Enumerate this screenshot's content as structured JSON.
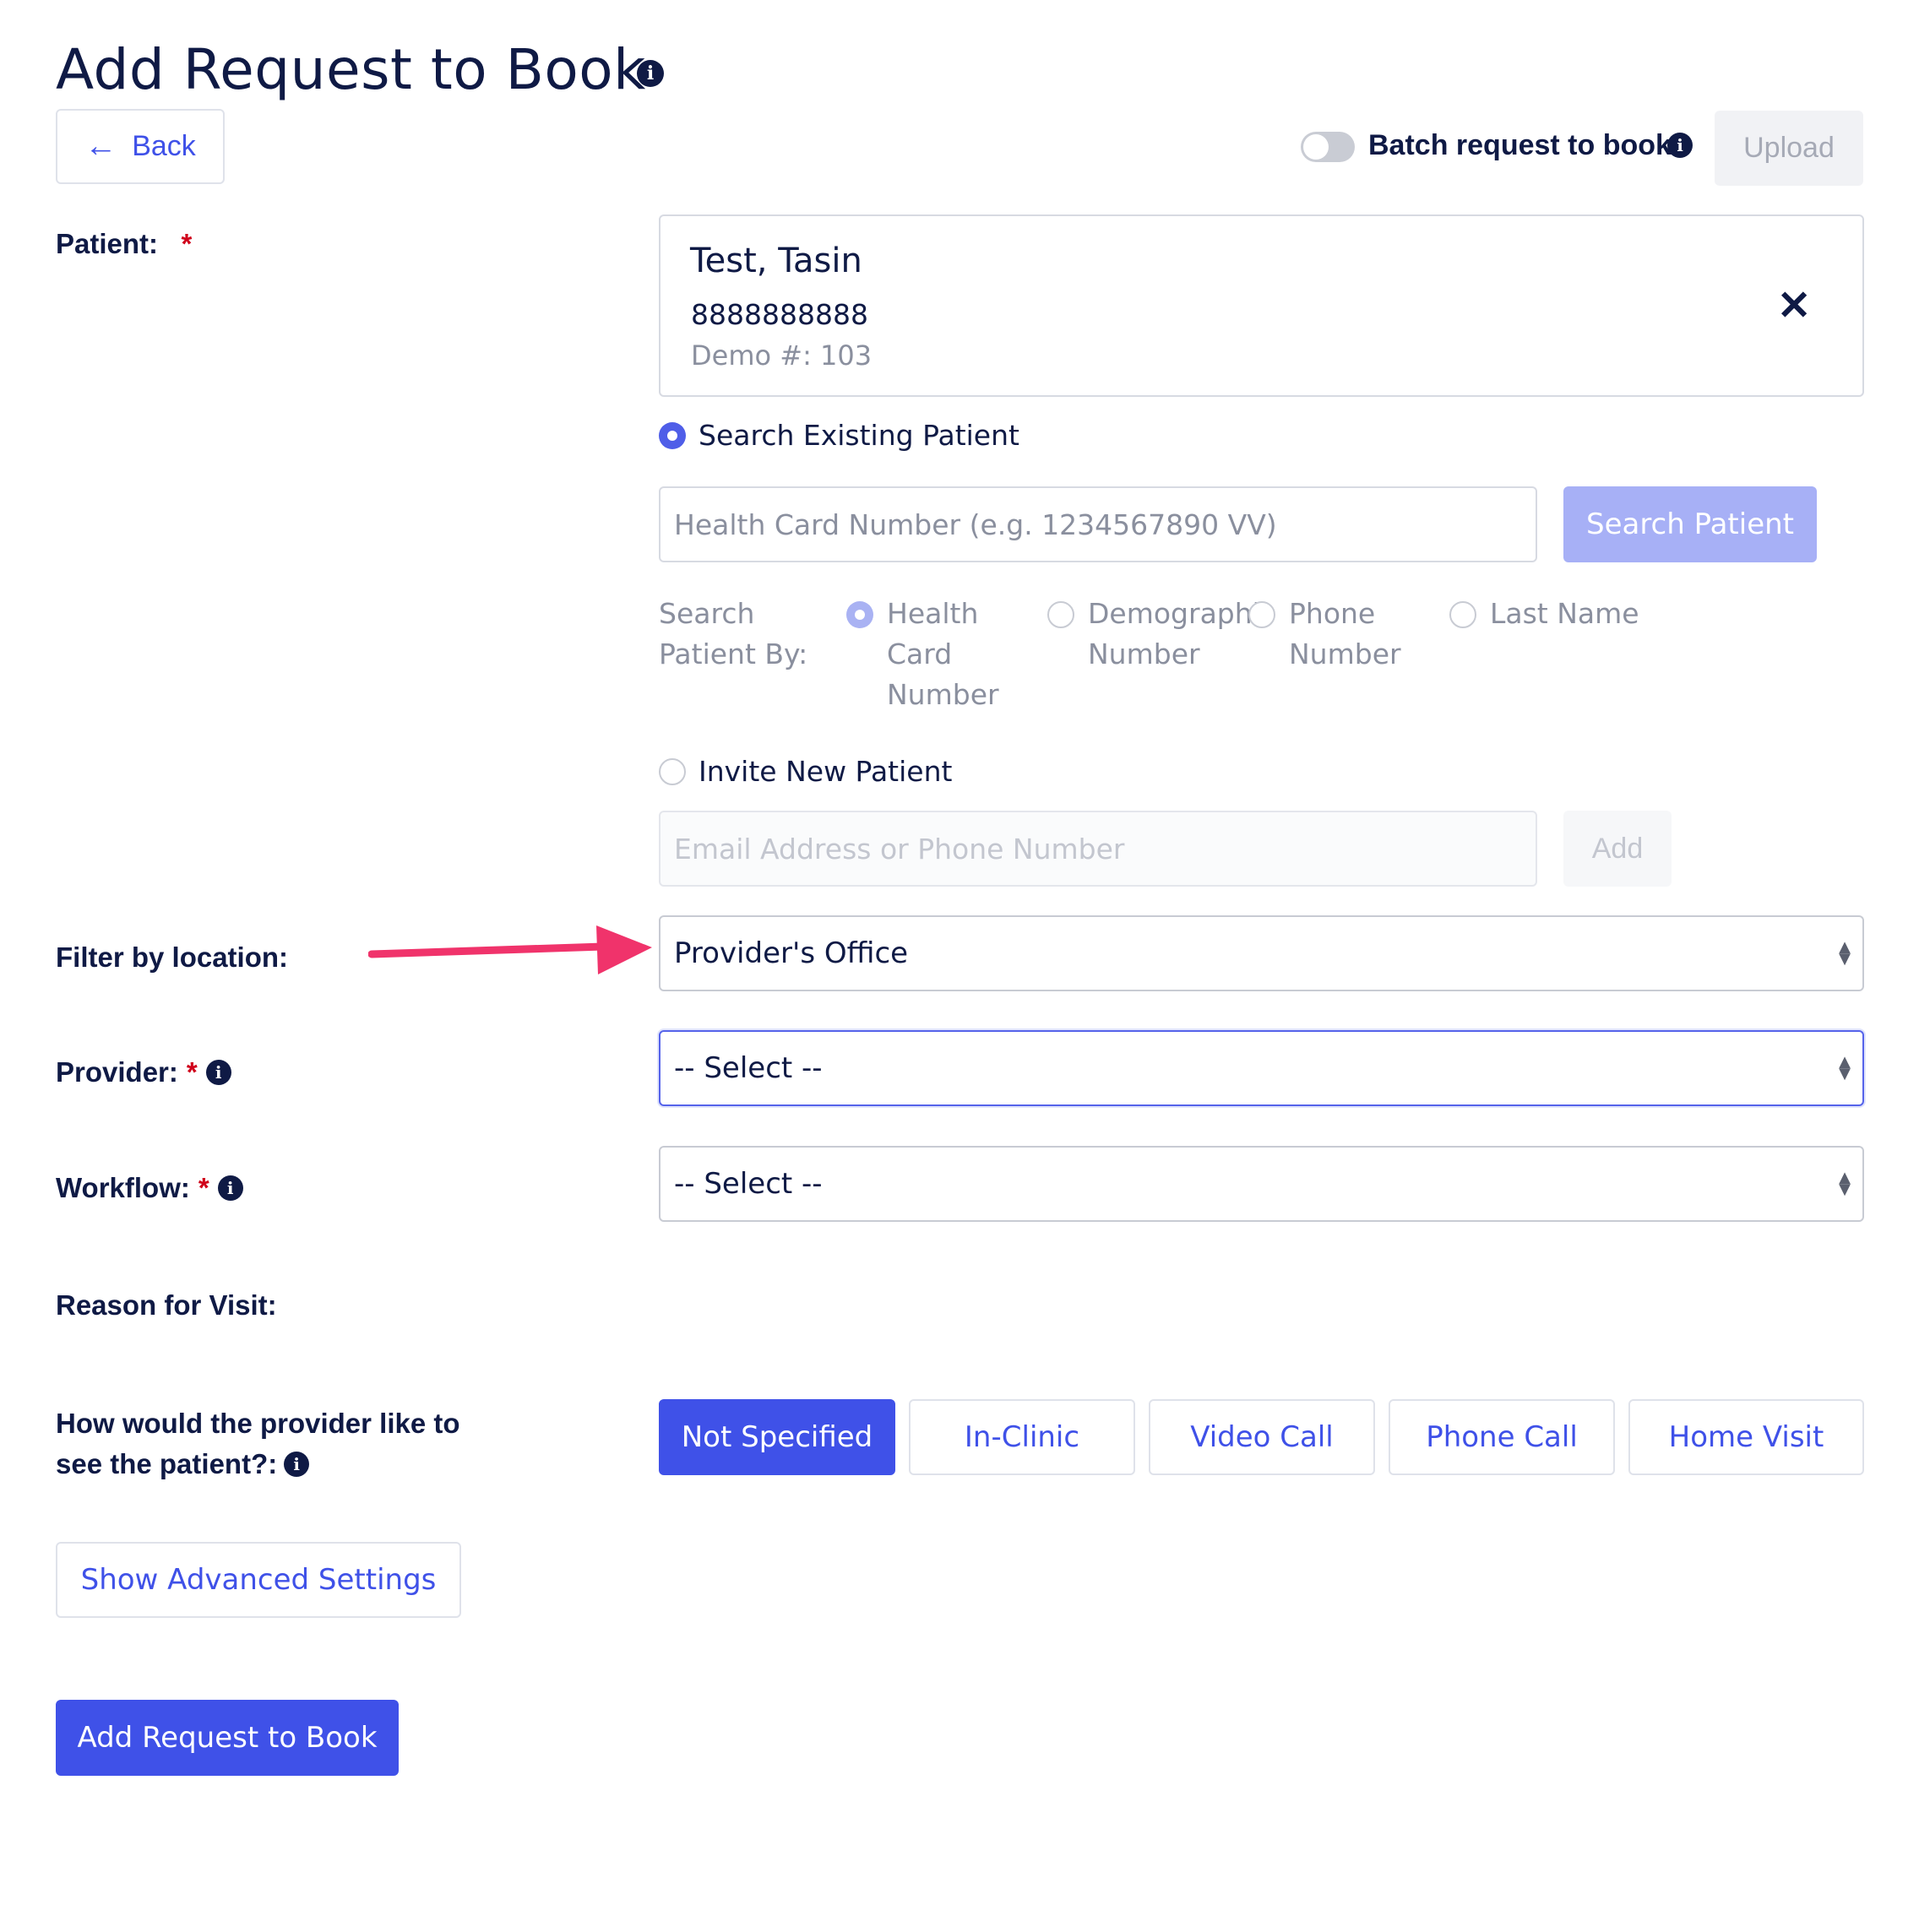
{
  "header": {
    "title": "Add Request to Book",
    "info_icon": "info-icon"
  },
  "toolbar": {
    "back_label": "Back",
    "back_icon": "arrow-left-icon",
    "batch_toggle_on": false,
    "batch_label": "Batch request to book",
    "upload_label": "Upload"
  },
  "patient": {
    "label": "Patient:",
    "required_mark": "*",
    "selected": {
      "name": "Test, Tasin",
      "phone": "8888888888",
      "demo": "Demo #: 103",
      "close_icon": "close-icon"
    },
    "search_existing_label": "Search Existing Patient",
    "search_placeholder": "Health Card Number (e.g. 1234567890 VV)",
    "search_button": "Search Patient",
    "search_by_label": [
      "Search",
      "Patient By:"
    ],
    "search_by_options": [
      {
        "lines": [
          "Health",
          "Card",
          "Number"
        ],
        "selected": true
      },
      {
        "lines": [
          "Demographic",
          "Number"
        ],
        "selected": false
      },
      {
        "lines": [
          "Phone",
          "Number"
        ],
        "selected": false
      },
      {
        "lines": [
          "Last Name"
        ],
        "selected": false
      }
    ],
    "invite_label": "Invite New Patient",
    "invite_placeholder": "Email Address or Phone Number",
    "invite_button": "Add"
  },
  "location": {
    "label": "Filter by location:",
    "value": "Provider's Office",
    "annotation_color": "#f0336b"
  },
  "provider": {
    "label": "Provider:",
    "required_mark": "*",
    "value": "-- Select --"
  },
  "workflow": {
    "label": "Workflow:",
    "required_mark": "*",
    "value": "-- Select --"
  },
  "reason": {
    "label": "Reason for Visit:"
  },
  "visit_mode": {
    "label_line1": "How would the provider like to",
    "label_line2": "see the patient?:",
    "options": [
      "Not Specified",
      "In-Clinic",
      "Video Call",
      "Phone Call",
      "Home Visit"
    ],
    "selected": "Not Specified"
  },
  "actions": {
    "advanced_label": "Show Advanced Settings",
    "submit_label": "Add Request to Book"
  },
  "colors": {
    "primary": "#3f51e8",
    "primary_light": "#a7b0f6",
    "text": "#0f1a45",
    "required": "#d0021b"
  }
}
